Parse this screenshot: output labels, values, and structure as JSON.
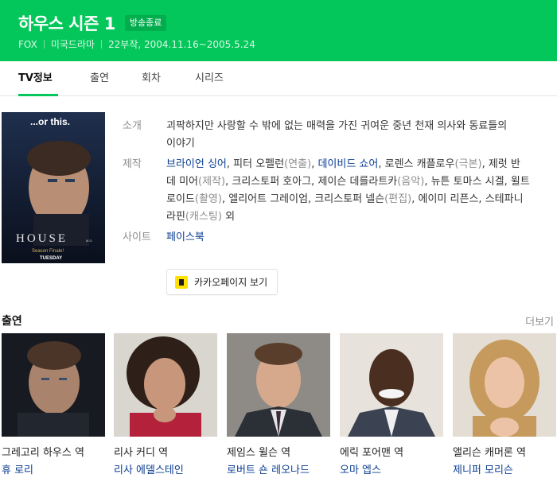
{
  "header": {
    "title": "하우스 시즌 1",
    "status_badge": "방송종료",
    "meta": [
      "FOX",
      "미국드라마",
      "22부작, 2004.11.16~2005.5.24"
    ]
  },
  "tabs": [
    {
      "label": "TV정보",
      "active": true
    },
    {
      "label": "출연",
      "active": false
    },
    {
      "label": "회차",
      "active": false
    },
    {
      "label": "시리즈",
      "active": false
    }
  ],
  "poster": {
    "tagline": "...or this.",
    "logo": "HOUSE",
    "logo_suffix": "M.D.",
    "caption1": "Season Finale!",
    "caption2": "TUESDAY"
  },
  "info": {
    "intro": {
      "label": "소개",
      "text": "괴팍하지만 사랑할 수 밖에 없는 매력을 가진 귀여운 중년 천재 의사와 동료들의 이야기"
    },
    "production": {
      "label": "제작",
      "credits": [
        {
          "name": "브라이언 싱어",
          "role": "",
          "linked": true
        },
        {
          "name": "피터 오펠런",
          "role": "(연출)",
          "linked": false
        },
        {
          "name": "데이비드 쇼어",
          "role": "",
          "linked": true
        },
        {
          "name": "로렌스 캐플로우",
          "role": "(극본)",
          "linked": false
        },
        {
          "name": "제럿 반 데 미어",
          "role": "(제작)",
          "linked": false
        },
        {
          "name": "크리스토퍼 호아그",
          "role": "",
          "linked": false
        },
        {
          "name": "제이슨 데를라트카",
          "role": "(음악)",
          "linked": false
        },
        {
          "name": "뉴튼 토마스 시겔",
          "role": "",
          "linked": false
        },
        {
          "name": "윌트 로이드",
          "role": "(촬영)",
          "linked": false
        },
        {
          "name": "엘리어트 그레이엄",
          "role": "",
          "linked": false
        },
        {
          "name": "크리스토퍼 넬슨",
          "role": "(편집)",
          "linked": false
        },
        {
          "name": "에이미 리픈스",
          "role": "",
          "linked": false
        },
        {
          "name": "스테파니 라핀",
          "role": "(캐스팅)",
          "linked": false
        }
      ],
      "suffix": "외"
    },
    "site": {
      "label": "사이트",
      "value": "페이스북"
    }
  },
  "kakao_button": "카카오페이지 보기",
  "cast_section": {
    "heading": "출연",
    "more": "더보기",
    "items": [
      {
        "role": "그레고리 하우스 역",
        "name": "휴 로리"
      },
      {
        "role": "리사 커디 역",
        "name": "리사 에델스테인"
      },
      {
        "role": "제임스 윌슨 역",
        "name": "로버트 숀 레오나드"
      },
      {
        "role": "에릭 포어맨 역",
        "name": "오마 엡스"
      },
      {
        "role": "앨리슨 캐머론 역",
        "name": "제니퍼 모리슨"
      }
    ]
  },
  "colors": {
    "brand": "#03c75a",
    "link": "#0a3d91",
    "muted": "#8e8e8e",
    "kakao": "#ffe100"
  }
}
